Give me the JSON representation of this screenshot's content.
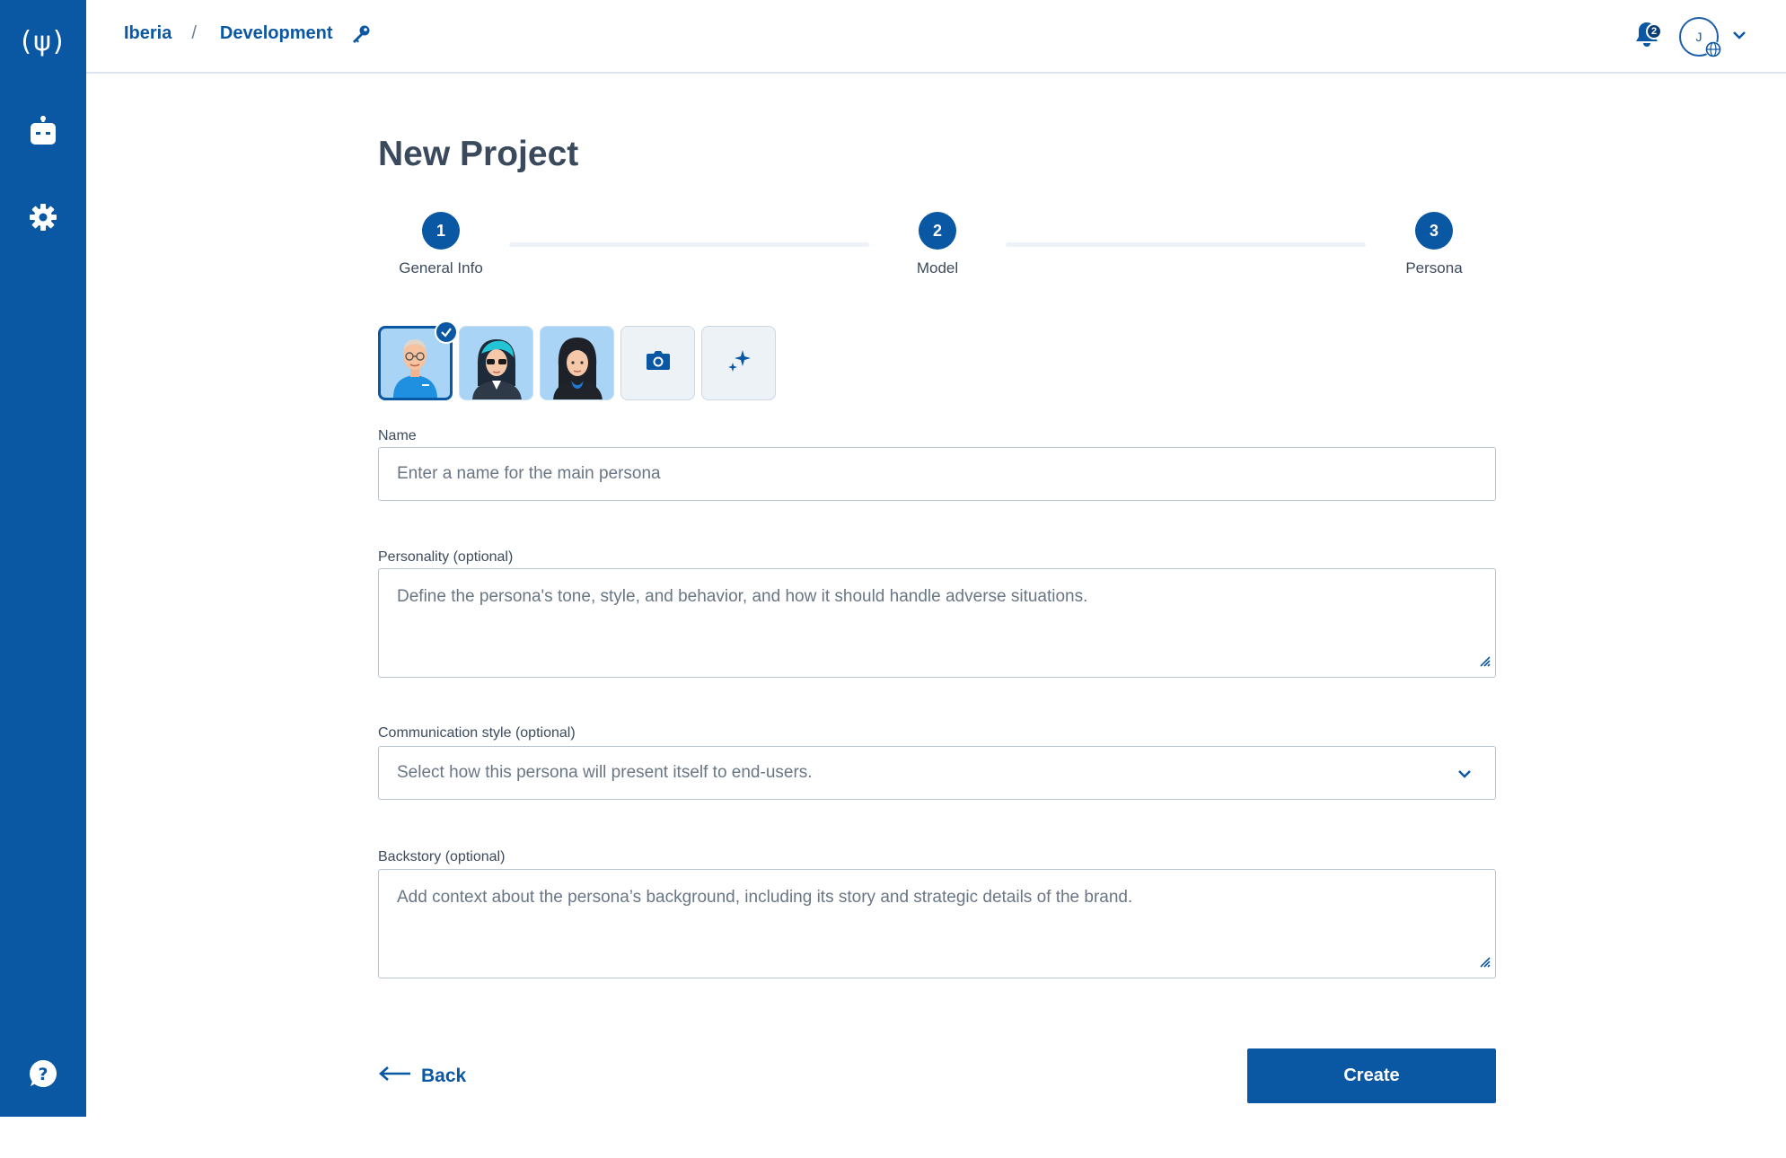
{
  "sidebar": {
    "logo": "(ψ)",
    "items": [
      {
        "name": "bots",
        "icon": "robot-icon"
      },
      {
        "name": "settings",
        "icon": "gear-icon"
      },
      {
        "name": "help",
        "icon": "help-icon"
      }
    ]
  },
  "header": {
    "breadcrumb": [
      "Iberia",
      "Development"
    ],
    "separator": "/",
    "notification_count": "2",
    "user_initial": "J"
  },
  "page": {
    "title": "New Project"
  },
  "stepper": [
    {
      "number": "1",
      "label": "General Info"
    },
    {
      "number": "2",
      "label": "Model"
    },
    {
      "number": "3",
      "label": "Persona"
    }
  ],
  "avatars": {
    "options": [
      "bald-man-avatar",
      "sunglasses-woman-avatar",
      "dark-hair-woman-avatar"
    ],
    "selected_index": 0,
    "upload_icon": "camera-icon",
    "generate_icon": "sparkle-icon"
  },
  "form": {
    "name": {
      "label": "Name",
      "placeholder": "Enter a name for the main persona",
      "value": ""
    },
    "personality": {
      "label": "Personality (optional)",
      "placeholder": "Define the persona's tone, style, and behavior, and how it should handle adverse situations.",
      "value": ""
    },
    "communication": {
      "label": "Communication style (optional)",
      "placeholder": "Select how this persona will present itself to end-users.",
      "value": ""
    },
    "backstory": {
      "label": "Backstory (optional)",
      "placeholder": "Add context about the persona’s background, including its story and strategic details of the brand.",
      "value": ""
    }
  },
  "actions": {
    "back": "Back",
    "create": "Create"
  },
  "colors": {
    "primary": "#0a57a4",
    "border": "#b9c3cf",
    "title": "#3a4a5c"
  }
}
